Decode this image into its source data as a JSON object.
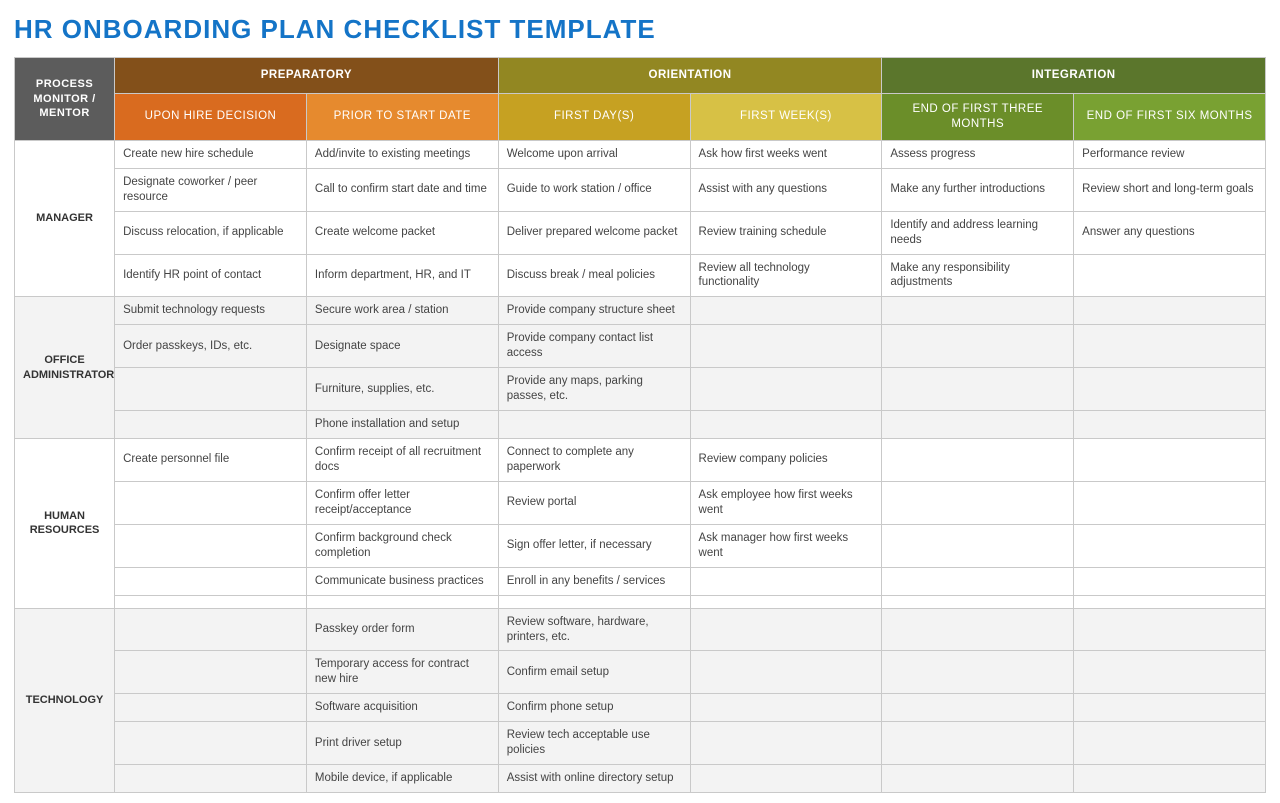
{
  "title": "HR ONBOARDING PLAN CHECKLIST TEMPLATE",
  "corner": "PROCESS MONITOR / MENTOR",
  "phases": {
    "prep": "PREPARATORY",
    "orient": "ORIENTATION",
    "integ": "INTEGRATION"
  },
  "subcols": {
    "hire": "UPON HIRE DECISION",
    "prior": "PRIOR TO START DATE",
    "firstday": "FIRST DAY(S)",
    "firstwk": "FIRST WEEK(S)",
    "mo3": "END OF FIRST THREE MONTHS",
    "mo6": "END OF FIRST SIX MONTHS"
  },
  "sections": [
    {
      "label": "MANAGER",
      "shade": false,
      "rows": [
        [
          "Create new hire schedule",
          "Add/invite to existing meetings",
          "Welcome upon arrival",
          "Ask how first weeks went",
          "Assess progress",
          "Performance review"
        ],
        [
          "Designate coworker / peer resource",
          "Call to confirm start date and time",
          "Guide to work station / office",
          "Assist with any questions",
          "Make any further introductions",
          "Review short and long-term goals"
        ],
        [
          "Discuss relocation, if applicable",
          "Create welcome packet",
          "Deliver prepared welcome packet",
          "Review training schedule",
          "Identify and address learning needs",
          "Answer any questions"
        ],
        [
          "Identify HR point of contact",
          "Inform department, HR, and IT",
          "Discuss break / meal policies",
          "Review all technology functionality",
          "Make any responsibility adjustments",
          ""
        ]
      ]
    },
    {
      "label": "OFFICE ADMINISTRATOR",
      "shade": true,
      "rows": [
        [
          "Submit technology requests",
          "Secure work area / station",
          "Provide company structure sheet",
          "",
          "",
          ""
        ],
        [
          "Order passkeys, IDs, etc.",
          "Designate space",
          "Provide company contact list access",
          "",
          "",
          ""
        ],
        [
          "",
          "Furniture, supplies, etc.",
          "Provide any maps, parking passes, etc.",
          "",
          "",
          ""
        ],
        [
          "",
          "Phone installation and setup",
          "",
          "",
          "",
          ""
        ]
      ]
    },
    {
      "label": "HUMAN RESOURCES",
      "shade": false,
      "rows": [
        [
          "Create personnel file",
          "Confirm receipt of all recruitment docs",
          "Connect to complete any paperwork",
          "Review company policies",
          "",
          ""
        ],
        [
          "",
          "Confirm offer letter receipt/acceptance",
          "Review portal",
          "Ask employee how first weeks went",
          "",
          ""
        ],
        [
          "",
          "Confirm background check completion",
          "Sign offer letter, if necessary",
          "Ask manager how first weeks went",
          "",
          ""
        ],
        [
          "",
          "Communicate business practices",
          "Enroll in any benefits / services",
          "",
          "",
          ""
        ],
        [
          "",
          "",
          "",
          "",
          "",
          ""
        ]
      ]
    },
    {
      "label": "TECHNOLOGY",
      "shade": true,
      "rows": [
        [
          "",
          "Passkey order form",
          "Review software, hardware, printers, etc.",
          "",
          "",
          ""
        ],
        [
          "",
          "Temporary access for contract new hire",
          "Confirm email setup",
          "",
          "",
          ""
        ],
        [
          "",
          "Software acquisition",
          "Confirm phone setup",
          "",
          "",
          ""
        ],
        [
          "",
          "Print driver setup",
          "Review tech acceptable use policies",
          "",
          "",
          ""
        ],
        [
          "",
          "Mobile device, if applicable",
          "Assist with online directory setup",
          "",
          "",
          ""
        ]
      ]
    }
  ]
}
